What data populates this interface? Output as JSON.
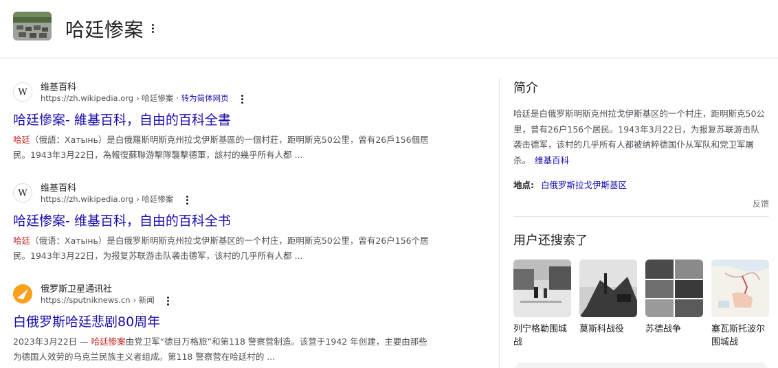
{
  "header": {
    "title": "哈廷惨案"
  },
  "results": [
    {
      "site_name": "维基百科",
      "url": "https://zh.wikipedia.org",
      "breadcrumb": "› 哈廷慘案",
      "translate": "· 转为简体网页",
      "title": "哈廷慘案- 維基百科，自由的百科全書",
      "snippet_highlight": "哈廷",
      "snippet_rest": "（俄語：Хатынь）是白俄羅斯明斯克州拉戈伊斯基區的一個村莊，距明斯克50公里，曾有26戶156個居民。1943年3月22日，為報復蘇聯游擊隊襲擊德軍，該村的幾乎所有人都 ..."
    },
    {
      "site_name": "维基百科",
      "url": "https://zh.wikipedia.org",
      "breadcrumb": "› 哈廷惨案",
      "title": "哈廷惨案- 维基百科，自由的百科全书",
      "snippet_highlight": "哈廷",
      "snippet_rest": "（俄语：Хатынь）是白俄罗斯明斯克州拉戈伊斯基区的一个村庄，距明斯克50公里，曾有26户156个居民。1943年3月22日，为报复苏联游击队袭击德军，该村的几乎所有人都 ..."
    },
    {
      "site_name": "俄罗斯卫星通讯社",
      "url": "https://sputniknews.cn",
      "breadcrumb": "› 新闻",
      "title": "白俄罗斯哈廷悲剧80周年",
      "snippet_date": "2023年3月22日 — ",
      "snippet_highlight": "哈廷惨案",
      "snippet_rest": "由党卫军“德目万格旅”和第118 警察营制造。该营于1942 年创建，主要由那些为德国人效劳的乌克兰民族主义者组成。第118 警察营在哈廷村的 ..."
    }
  ],
  "knowledge_panel": {
    "heading": "简介",
    "description": "哈廷是白俄罗斯明斯克州拉戈伊斯基区的一个村庄，距明斯克50公里，曾有26户156个居民。1943年3月22日，为报复苏联游击队袭击德军，该村的几乎所有人都被纳粹德国仆从军队和党卫军屠杀。",
    "source_link": "维基百科",
    "location_label": "地点:",
    "location_value": "白俄罗斯拉戈伊斯基区",
    "feedback": "反馈",
    "also_searched_heading": "用户还搜索了",
    "also_searched": [
      {
        "label": "列宁格勒围城战",
        "icon": "photo-thumbnail"
      },
      {
        "label": "莫斯科战役",
        "icon": "photo-thumbnail"
      },
      {
        "label": "苏德战争",
        "icon": "photo-thumbnail"
      },
      {
        "label": "塞瓦斯托波尔围城战",
        "icon": "map-thumbnail"
      }
    ]
  },
  "colors": {
    "link": "#1a0dab",
    "highlight": "#c5221f",
    "snippet": "#4d5156"
  }
}
